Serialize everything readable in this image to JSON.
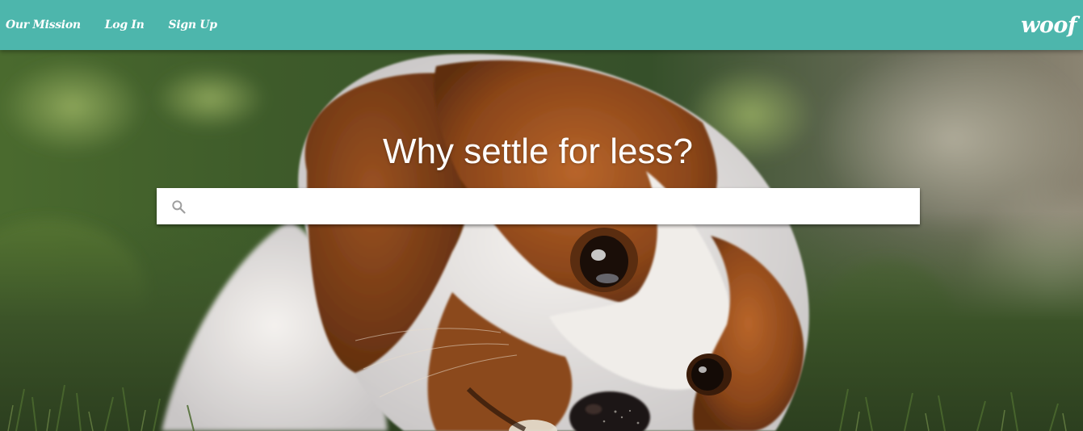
{
  "nav": {
    "links": [
      {
        "label": "Our Mission"
      },
      {
        "label": "Log In"
      },
      {
        "label": "Sign Up"
      }
    ],
    "brand": "woof",
    "color": "#4db6ac"
  },
  "hero": {
    "headline": "Why settle for less?",
    "background_subject": "puppy-lying-in-grass-photo"
  },
  "search": {
    "placeholder": "",
    "value": "",
    "icon": "search-icon"
  }
}
